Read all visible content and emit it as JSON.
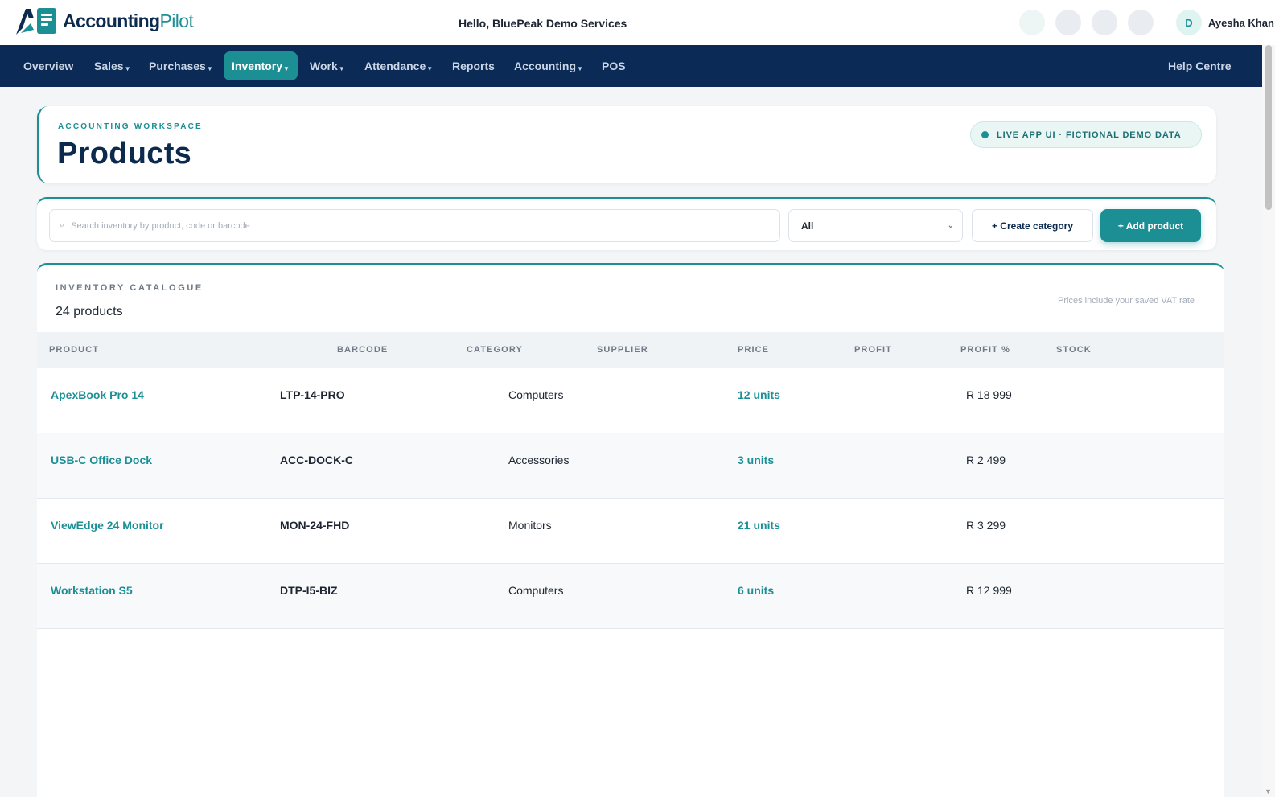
{
  "app": {
    "brand_main": "Accounting",
    "brand_accent": "Pilot",
    "greeting": "Hello, BluePeak Demo Services",
    "user_initial": "D",
    "user_name": "Ayesha Khan"
  },
  "nav": {
    "items": [
      {
        "label": "Overview",
        "dropdown": false
      },
      {
        "label": "Sales",
        "dropdown": true
      },
      {
        "label": "Purchases",
        "dropdown": true
      },
      {
        "label": "Inventory",
        "dropdown": true,
        "active": true
      },
      {
        "label": "Work",
        "dropdown": true
      },
      {
        "label": "Attendance",
        "dropdown": true
      },
      {
        "label": "Reports",
        "dropdown": false
      },
      {
        "label": "Accounting",
        "dropdown": true
      },
      {
        "label": "POS",
        "dropdown": false
      }
    ],
    "help": "Help Centre"
  },
  "header": {
    "eyebrow": "ACCOUNTING WORKSPACE",
    "title": "Products",
    "badge": "LIVE APP UI · FICTIONAL DEMO DATA"
  },
  "toolbar": {
    "search_placeholder": "Search inventory by product, code or barcode",
    "filter_value": "All",
    "create_category": "+ Create category",
    "add_product": "+ Add product"
  },
  "catalogue": {
    "title": "INVENTORY CATALOGUE",
    "count": "24 products",
    "note": "Prices include your saved VAT rate",
    "columns": [
      "PRODUCT",
      "BARCODE",
      "CATEGORY",
      "SUPPLIER",
      "PRICE",
      "PROFIT",
      "PROFIT %",
      "STOCK"
    ],
    "rows": [
      {
        "name": "ApexBook Pro 14",
        "code": "LTP-14-PRO",
        "category": "Computers",
        "stock": "12 units",
        "price": "R 18 999"
      },
      {
        "name": "USB-C Office Dock",
        "code": "ACC-DOCK-C",
        "category": "Accessories",
        "stock": "3 units",
        "price": "R 2 499"
      },
      {
        "name": "ViewEdge 24 Monitor",
        "code": "MON-24-FHD",
        "category": "Monitors",
        "stock": "21 units",
        "price": "R 3 299"
      },
      {
        "name": "Workstation S5",
        "code": "DTP-I5-BIZ",
        "category": "Computers",
        "stock": "6 units",
        "price": "R 12 999"
      }
    ]
  },
  "colors": {
    "brand_navy": "#0b2a56",
    "accent_teal": "#1c8f95",
    "page_bg": "#f3f5f7"
  }
}
